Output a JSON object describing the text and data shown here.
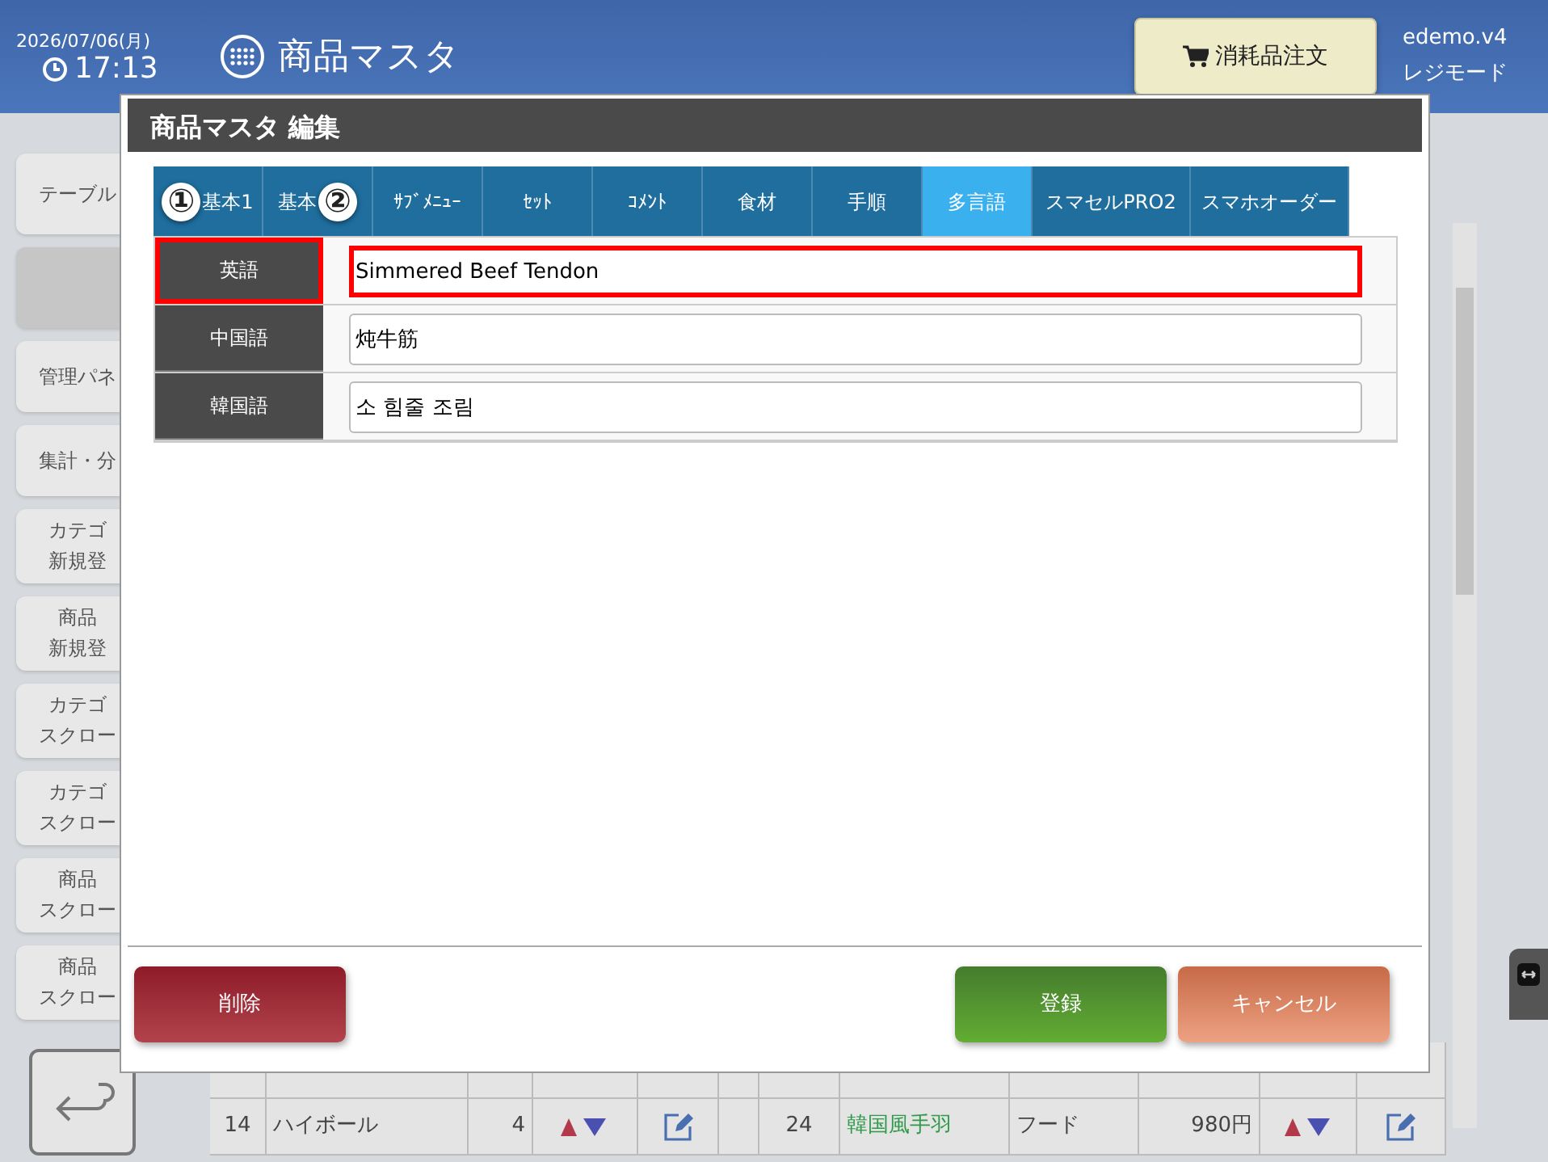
{
  "header": {
    "date": "2026/07/06(月)",
    "time": "17:13",
    "title": "商品マスタ",
    "order_button": "消耗品注文",
    "account": "edemo.v4",
    "mode": "レジモード"
  },
  "sidebar": {
    "items": [
      {
        "lines": [
          "テーブル"
        ],
        "selected": false
      },
      {
        "selected": true
      },
      {
        "lines": [
          "管理パネ"
        ],
        "selected": false
      },
      {
        "lines": [
          "集計・分"
        ],
        "selected": false
      },
      {
        "lines": [
          "カテゴ",
          "新規登"
        ],
        "selected": false
      },
      {
        "lines": [
          "商品",
          "新規登"
        ],
        "selected": false
      },
      {
        "lines": [
          "カテゴ",
          "スクロー"
        ],
        "selected": false
      },
      {
        "lines": [
          "カテゴ",
          "スクロー"
        ],
        "selected": false
      },
      {
        "lines": [
          "商品",
          "スクロー"
        ],
        "selected": false
      },
      {
        "lines": [
          "商品",
          "スクロー"
        ],
        "selected": false
      }
    ]
  },
  "background_table": {
    "visible_row": [
      "14",
      "ハイボール",
      "4",
      "24",
      "韓国風手羽",
      "フード",
      "980円"
    ]
  },
  "dialog": {
    "title": "商品マスタ 編集",
    "tabs": [
      {
        "label": "基本1",
        "selected": false
      },
      {
        "label": "基本",
        "selected": false
      },
      {
        "label": "ｻﾌﾞﾒﾆｭｰ",
        "selected": false
      },
      {
        "label": "ｾｯﾄ",
        "selected": false
      },
      {
        "label": "ｺﾒﾝﾄ",
        "selected": false
      },
      {
        "label": "食材",
        "selected": false
      },
      {
        "label": "手順",
        "selected": false
      },
      {
        "label": "多言語",
        "selected": true
      },
      {
        "label": "スマセルPRO2",
        "selected": false
      },
      {
        "label": "スマホオーダー",
        "selected": false
      }
    ],
    "rows": [
      {
        "label": "英語",
        "value": "Simmered Beef Tendon",
        "highlighted": true
      },
      {
        "label": "中国語",
        "value": "炖牛筋",
        "highlighted": false
      },
      {
        "label": "韓国語",
        "value": "소 힘줄 조림",
        "highlighted": false
      }
    ],
    "annotations": [
      {
        "text": "①"
      },
      {
        "text": "②"
      }
    ],
    "buttons": [
      {
        "label": "削除",
        "kind": "danger"
      },
      {
        "label": "登録",
        "kind": "save"
      },
      {
        "label": "キャンセル",
        "kind": "cancel"
      }
    ]
  }
}
